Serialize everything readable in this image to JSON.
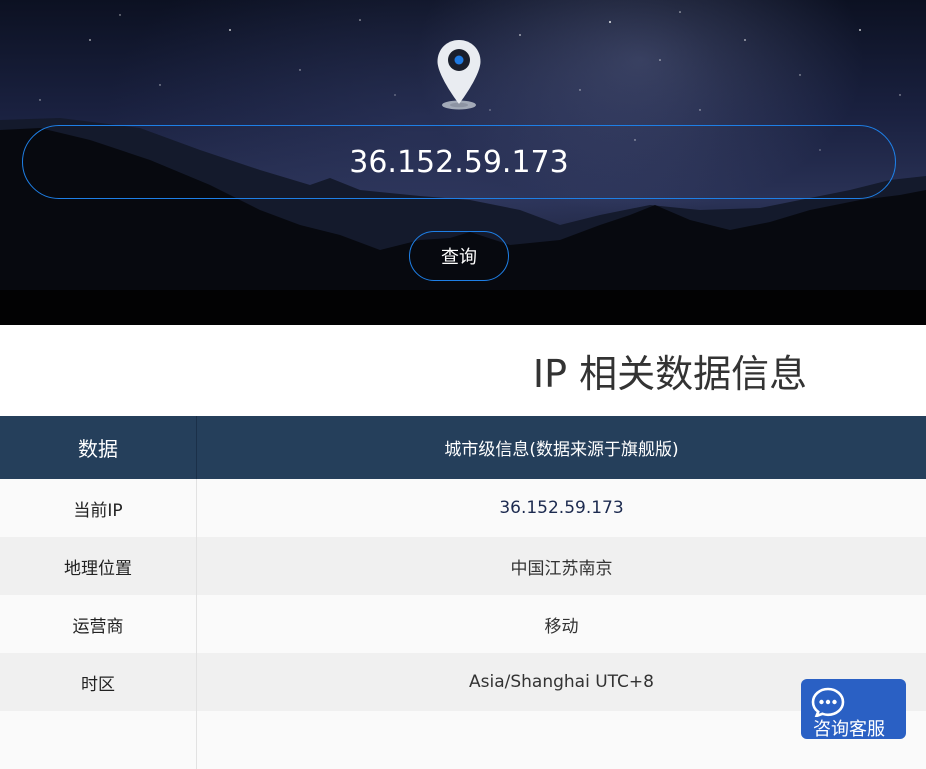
{
  "search": {
    "value": "36.152.59.173",
    "button_label": "查询"
  },
  "section": {
    "title": "IP 相关数据信息"
  },
  "table": {
    "headers": [
      "数据",
      "城市级信息(数据来源于旗舰版)"
    ],
    "rows": [
      {
        "key": "当前IP",
        "value": "36.152.59.173"
      },
      {
        "key": "地理位置",
        "value": "中国江苏南京"
      },
      {
        "key": "运营商",
        "value": "移动"
      },
      {
        "key": "时区",
        "value": "Asia/Shanghai UTC+8"
      }
    ]
  },
  "chat": {
    "label": "咨询客服",
    "icon": "chat-bubble-icon"
  },
  "colors": {
    "accent": "#1e7fe6",
    "header_bg": "#253f5b",
    "chat_bg": "#2a60c4",
    "pin_dot": "#1f7ae0"
  },
  "icons": {
    "pin": "location-pin-icon"
  }
}
